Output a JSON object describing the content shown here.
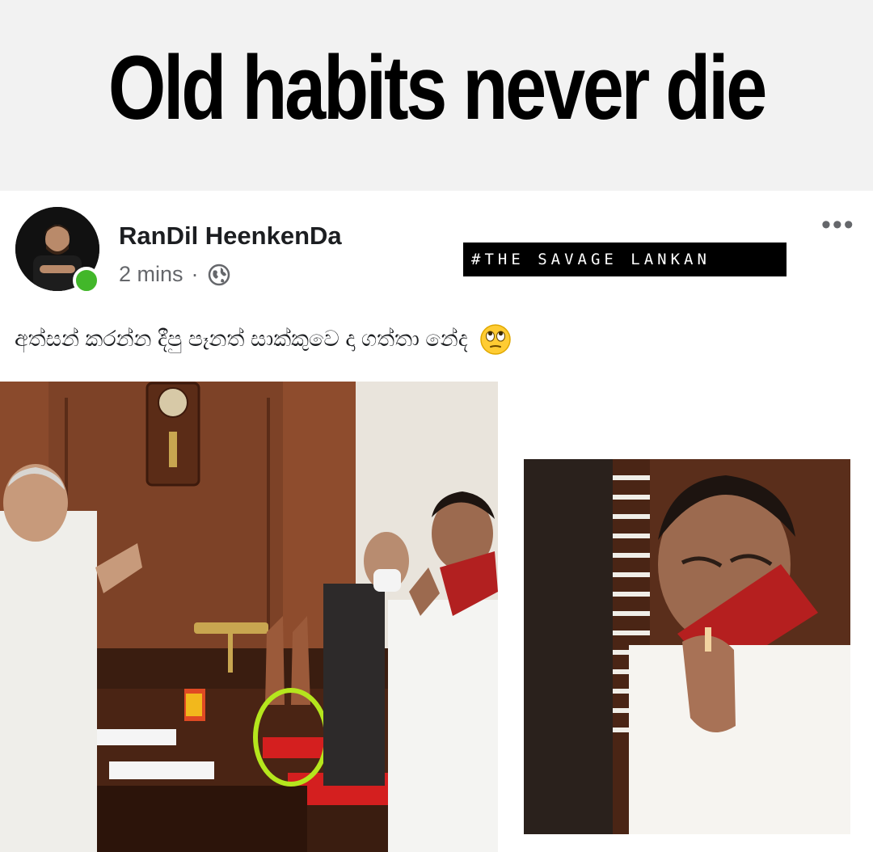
{
  "banner": {
    "title": "Old habits never die"
  },
  "post": {
    "author": "RanDil HeenkenDa",
    "time": "2 mins",
    "separator": "·",
    "privacy_icon": "globe-icon",
    "more_label": "•••",
    "watermark": "#THE SAVAGE LANKAN",
    "caption": "අත්සන් කරන්න දීපු පෑනත් සාක්කුවෙ දා ගත්තා නේද",
    "caption_emoji": "eye-roll-emoji"
  },
  "colors": {
    "online": "#42b72a",
    "highlight_circle": "#b5e61d",
    "name": "#1c1e21",
    "meta": "#65676b"
  }
}
